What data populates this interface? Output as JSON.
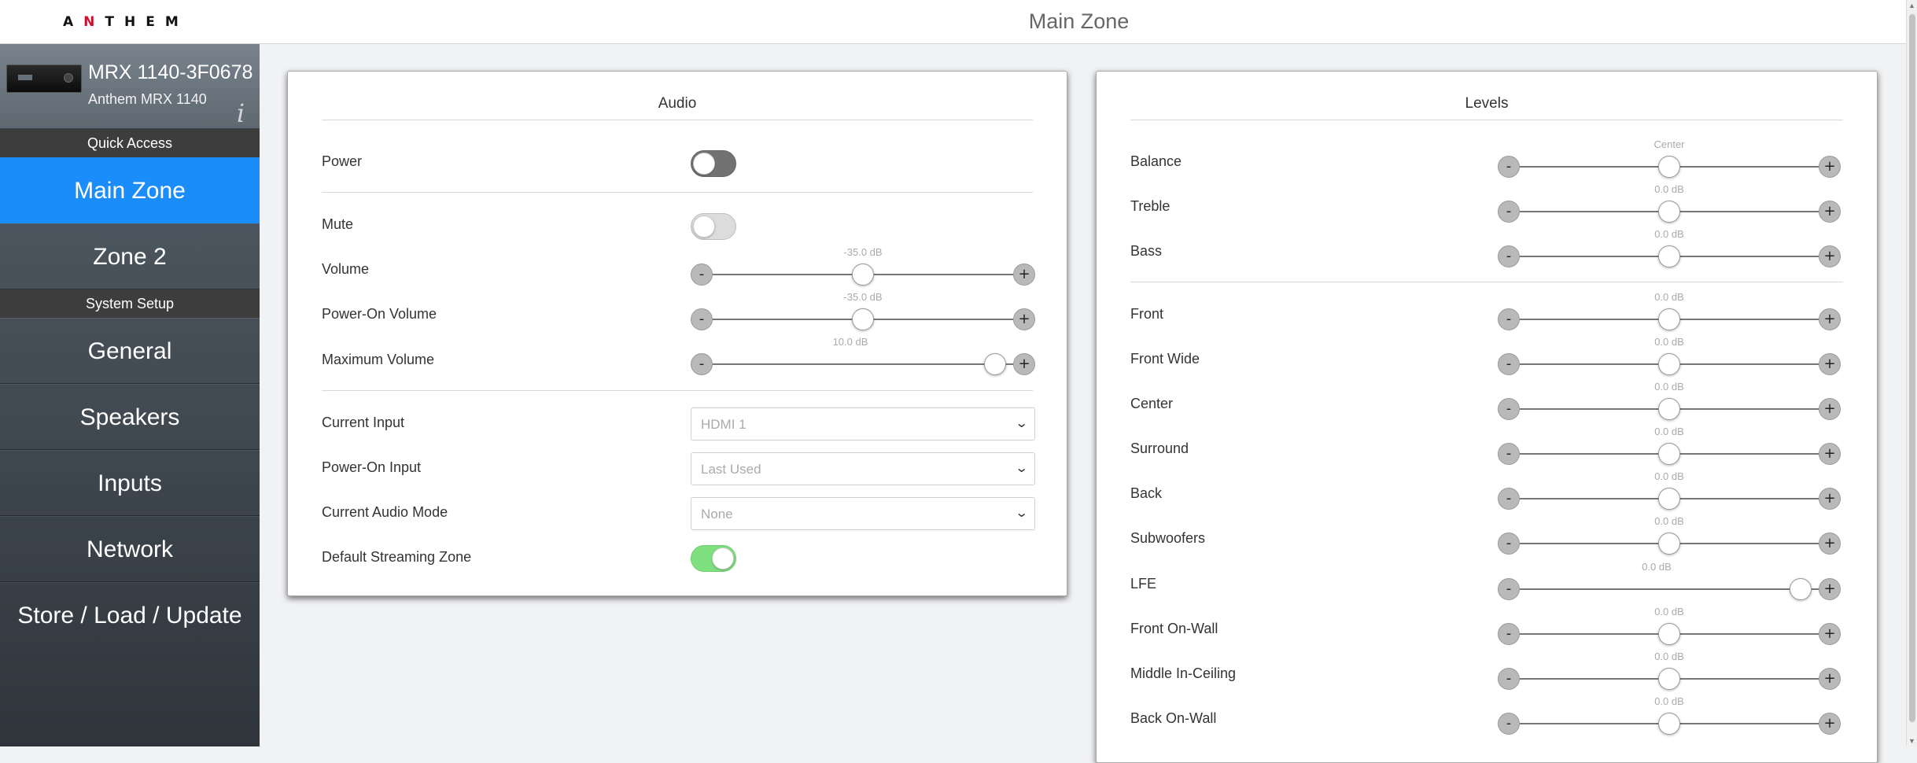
{
  "header": {
    "logo_text": "ANTHEM",
    "page_title": "Main Zone"
  },
  "sidebar": {
    "device_name": "MRX 1140-3F0678",
    "device_model": "Anthem MRX 1140",
    "info_icon": "info-icon",
    "quick_access_label": "Quick Access",
    "quick_access": [
      {
        "label": "Main Zone",
        "active": true
      },
      {
        "label": "Zone 2",
        "active": false
      }
    ],
    "system_setup_label": "System Setup",
    "system_setup": [
      {
        "label": "General"
      },
      {
        "label": "Speakers"
      },
      {
        "label": "Inputs"
      },
      {
        "label": "Network"
      },
      {
        "label": "Store / Load / Update"
      }
    ]
  },
  "audio": {
    "title": "Audio",
    "power": {
      "label": "Power",
      "state": "off"
    },
    "mute": {
      "label": "Mute",
      "state": "off"
    },
    "volume": {
      "label": "Volume",
      "value_label": "-35.0 dB",
      "position": 0.5
    },
    "power_on_volume": {
      "label": "Power-On Volume",
      "value_label": "-35.0 dB",
      "position": 0.5
    },
    "maximum_volume": {
      "label": "Maximum Volume",
      "value_label": "10.0 dB",
      "position": 0.94
    },
    "current_input": {
      "label": "Current Input",
      "value": "HDMI 1"
    },
    "power_on_input": {
      "label": "Power-On Input",
      "value": "Last Used"
    },
    "current_audio_mode": {
      "label": "Current Audio Mode",
      "value": "None"
    },
    "default_streaming_zone": {
      "label": "Default Streaming Zone",
      "state": "on"
    }
  },
  "levels": {
    "title": "Levels",
    "tone": [
      {
        "label": "Balance",
        "value_label": "Center",
        "position": 0.5
      },
      {
        "label": "Treble",
        "value_label": "0.0 dB",
        "position": 0.5
      },
      {
        "label": "Bass",
        "value_label": "0.0 dB",
        "position": 0.5
      }
    ],
    "channels": [
      {
        "label": "Front",
        "value_label": "0.0 dB",
        "position": 0.5
      },
      {
        "label": "Front Wide",
        "value_label": "0.0 dB",
        "position": 0.5
      },
      {
        "label": "Center",
        "value_label": "0.0 dB",
        "position": 0.5
      },
      {
        "label": "Surround",
        "value_label": "0.0 dB",
        "position": 0.5
      },
      {
        "label": "Back",
        "value_label": "0.0 dB",
        "position": 0.5
      },
      {
        "label": "Subwoofers",
        "value_label": "0.0 dB",
        "position": 0.5
      },
      {
        "label": "LFE",
        "value_label": "0.0 dB",
        "position": 0.94
      },
      {
        "label": "Front On-Wall",
        "value_label": "0.0 dB",
        "position": 0.5
      },
      {
        "label": "Middle In-Ceiling",
        "value_label": "0.0 dB",
        "position": 0.5
      },
      {
        "label": "Back On-Wall",
        "value_label": "0.0 dB",
        "position": 0.5
      }
    ],
    "minus_label": "-",
    "plus_label": "+"
  },
  "colors": {
    "accent": "#1b8dfb",
    "toggle_on": "#7ee07e",
    "sidebar_top": "#55606a"
  }
}
